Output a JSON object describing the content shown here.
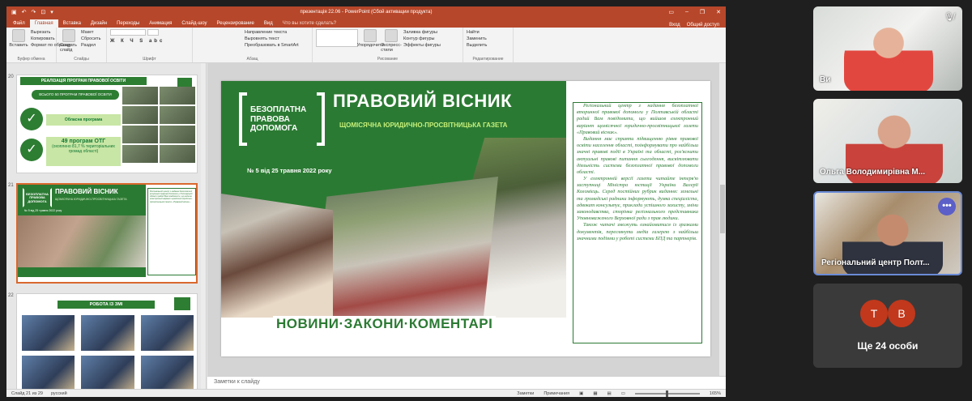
{
  "app": {
    "title": "презентація 22.06 - PowerPoint (Сбой активации продукта)",
    "quick_access_icons": [
      "save-icon",
      "undo-icon",
      "redo-icon",
      "start-from-beginning-icon",
      "customize-icon"
    ],
    "window_controls": [
      "ribbon-display-icon",
      "minimize-icon",
      "restore-icon",
      "close-icon"
    ]
  },
  "ribbon_tabs": [
    "Файл",
    "Главная",
    "Вставка",
    "Дизайн",
    "Переходы",
    "Анимация",
    "Слайд-шоу",
    "Рецензирование",
    "Вид"
  ],
  "active_tab": "Главная",
  "tell_me": "Что вы хотите сделать?",
  "account": {
    "signin": "Вход",
    "share": "Общий доступ"
  },
  "ribbon": {
    "clipboard": {
      "paste": "Вставить",
      "cut": "Вырезать",
      "copy": "Копировать",
      "format_painter": "Формат по образцу",
      "label": "Буфер обмена"
    },
    "slides": {
      "new_slide": "Создать слайд",
      "layout": "Макет",
      "reset": "Сбросить",
      "section": "Раздел",
      "label": "Слайды"
    },
    "font": {
      "label": "Шрифт"
    },
    "paragraph": {
      "text_direction": "Направление текста",
      "align_text": "Выровнять текст",
      "smartart": "Преобразовать в SmartArt",
      "label": "Абзац"
    },
    "drawing": {
      "arrange": "Упорядочить",
      "quick_styles": "Экспресс-стили",
      "fill": "Заливка фигуры",
      "outline": "Контур фигуры",
      "effects": "Эффекты фигуры",
      "label": "Рисование"
    },
    "editing": {
      "find": "Найти",
      "replace": "Заменить",
      "select": "Выделить",
      "label": "Редактирование"
    }
  },
  "thumbnails": {
    "slide20": {
      "number": "20",
      "banner": "РЕАЛІЗАЦІЯ ПРОГРАМ ПРАВОВОЇ ОСВІТИ",
      "pill": "ВСЬОГО 50 ПРОГРАМ ПРАВОВОЇ ОСВІТИ",
      "box1": "Обласна програма",
      "box2a": "49 програм ОТГ",
      "box2b": "(охоплено 81,7 % територіальних громад області)"
    },
    "slide21": {
      "number": "21",
      "title": "ПРАВОВИЙ ВІСНИК",
      "subtitle": "ЩОМІСЯЧНА ЮРИДИЧНО-ПРОСВІТНИЦЬКА ГАЗЕТА",
      "logo": "БЕЗОПЛАТНА ПРАВОВА ДОПОМОГА",
      "issue": "№ 5 від 25 травня 2022 року",
      "news": "НОВИНИ · ЗАКОНИ · КОМЕНТАРІ",
      "text": "Регіональний центр з надання безоплатної вторинної правової допомоги у Полтавській області радий Вам повідомити, що вийшов електронний варіант щомісячної юридично-просвітницької газети «Правовий вісник»."
    },
    "slide22": {
      "number": "22",
      "banner": "РОБОТА ІЗ ЗМІ"
    }
  },
  "slide": {
    "logo": "БЕЗОПЛАТНА ПРАВОВА ДОПОМОГА",
    "title": "ПРАВОВИЙ ВІСНИК",
    "subtitle": "ЩОМІСЯЧНА ЮРИДИЧНО-ПРОСВІТНИЦЬКА ГАЗЕТА",
    "issue": "№ 5 від 25 травня 2022 року",
    "footer": "НОВИНИ·ЗАКОНИ·КОМЕНТАРІ",
    "paragraphs": [
      "Регіональний центр з надання безоплатної вторинної правової допомоги у Полтавській області радий Вам повідомити, що вийшов електронний варіант щомісячної юридично-просвітницької газети «Правовий вісник».",
      "Видання має сприяти підвищенню рівня правової освіти населення області, поінформувати про найбільш значні правові події в Україні та області, роз'яснити актуальні правові питання сьогодення, висвітлювати діяльність системи безоплатної правової допомоги області.",
      "У електронній версії газети читайте інтерв'ю заступниці Міністра юстиції України Валерії Коломієць. Серед постійних рубрик видання: земельні та громадські радники інформують, думка спеціаліста, адвокат консультує, приклади успішного захисту, зміни законодавства, сторінка регіонального представника Уповноваженого Верховної ради з прав людини.",
      "Також читачі зможуть ознайомитися із зразками документів, переглянути медіа галерею з найбільш значними подіями у роботі системи БПД та партнерів."
    ]
  },
  "notes_placeholder": "Заметки к слайду",
  "status": {
    "slide_info": "Слайд 21 из 29",
    "language": "русский",
    "notes": "Заметки",
    "comments": "Примечания",
    "zoom": "165%"
  },
  "participants": [
    {
      "name": "Ви"
    },
    {
      "name": "Ольга Володимирівна М..."
    },
    {
      "name": "Регіональний центр Полт..."
    }
  ],
  "more_avatars": [
    "T",
    "B"
  ],
  "more_text": "Ще 24 особи",
  "colors": {
    "ppt_accent": "#b7472a",
    "slide_green": "#2b7a33",
    "teams_purple": "#5b5fc7"
  }
}
